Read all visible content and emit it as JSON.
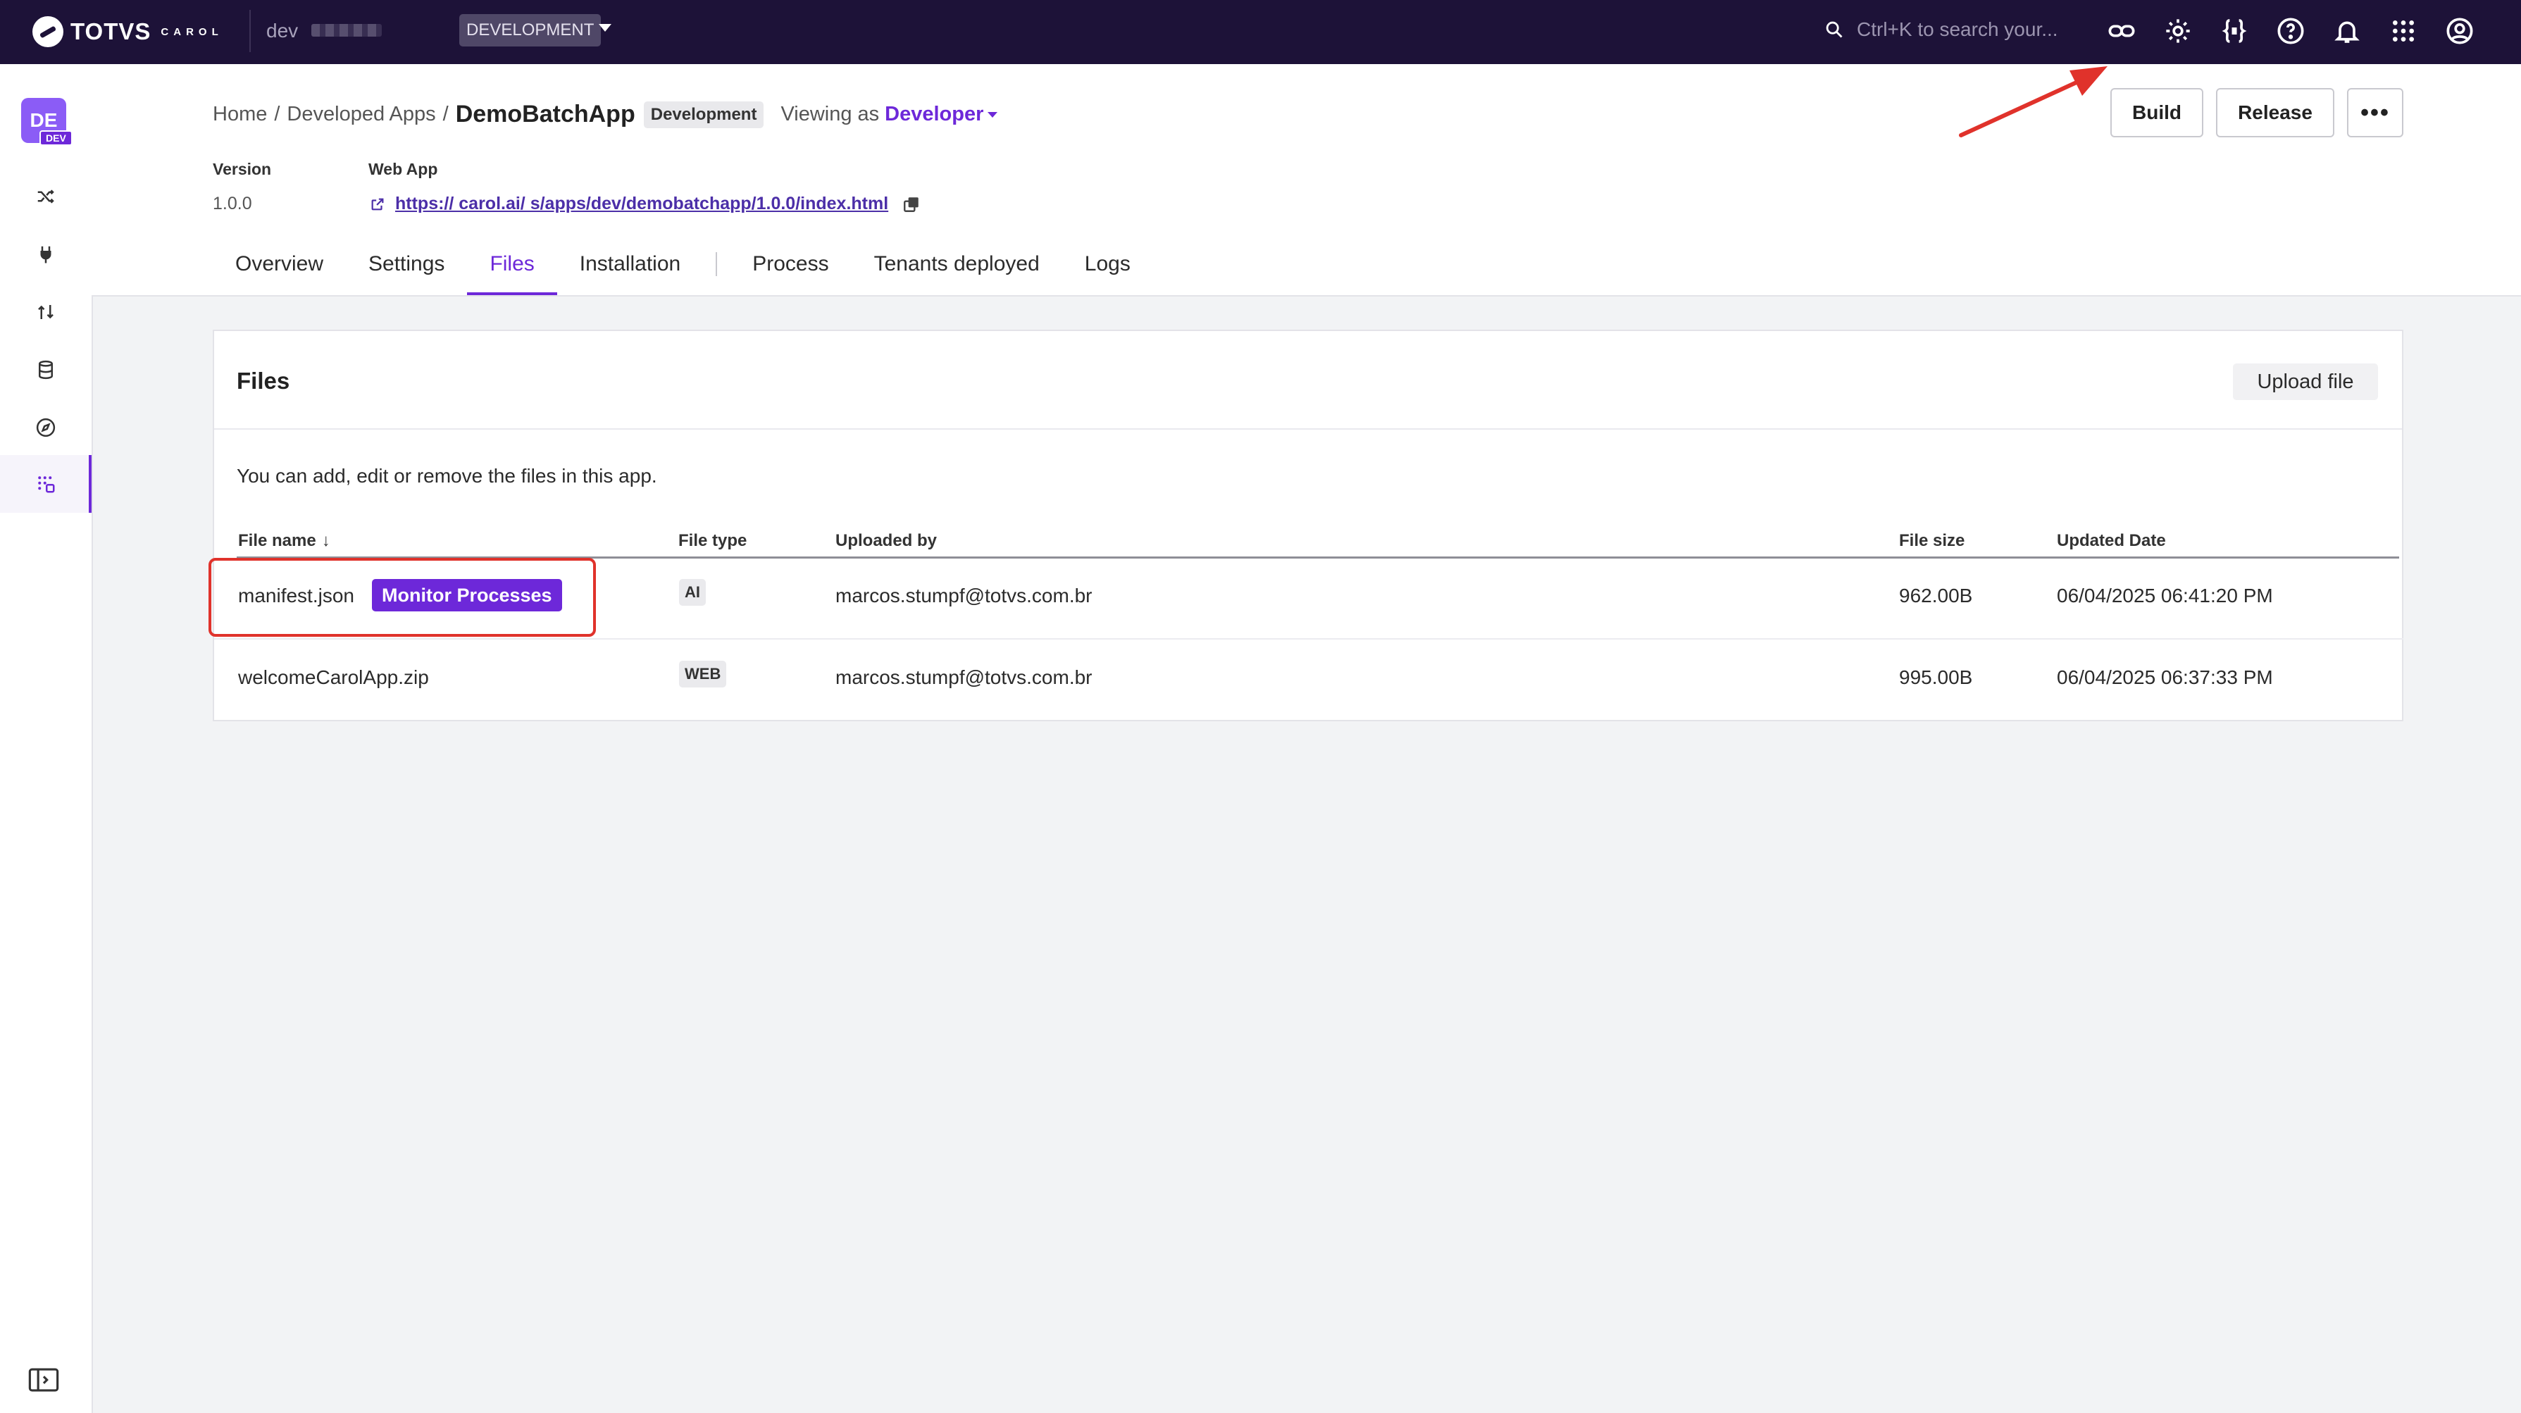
{
  "topbar": {
    "logo_text": "TOTVS",
    "logo_sub": "CAROL",
    "env_name": "dev",
    "env_badge": "DEVELOPMENT",
    "search_placeholder": "Ctrl+K to search your..."
  },
  "topbar_icons": [
    "link-icon",
    "settings-icon",
    "code-icon",
    "help-icon",
    "bell-icon",
    "apps-grid-icon",
    "account-icon"
  ],
  "rail": {
    "avatar": "DE",
    "avatar_badge": "DEV",
    "items": [
      "shuffle-icon",
      "plug-icon",
      "process-arrows-icon",
      "database-icon",
      "compass-icon",
      "apps-icon"
    ]
  },
  "breadcrumb": {
    "home": "Home",
    "sep": "/",
    "developed_apps": "Developed Apps",
    "app_name": "DemoBatchApp",
    "env_pill": "Development",
    "viewing_as": "Viewing as",
    "role": "Developer"
  },
  "actions": {
    "build": "Build",
    "release": "Release",
    "more": "•••"
  },
  "meta": {
    "version_label": "Version",
    "version_value": "1.0.0",
    "webapp_label": "Web App",
    "webapp_url": "https://        carol.ai/          s/apps/dev/demobatchapp/1.0.0/index.html"
  },
  "tabs": [
    "Overview",
    "Settings",
    "Files",
    "Installation",
    "Process",
    "Tenants deployed",
    "Logs"
  ],
  "active_tab": "Files",
  "files_card": {
    "title": "Files",
    "upload_button": "Upload file",
    "description": "You can add, edit or remove the files in this app.",
    "columns": [
      "File name",
      "File type",
      "Uploaded by",
      "File size",
      "Updated Date"
    ],
    "sort_indicator": "↓",
    "rows": [
      {
        "name": "manifest.json",
        "badge": "Monitor Processes",
        "type": "AI",
        "uploaded_by": "marcos.stumpf@totvs.com.br",
        "size": "962.00B",
        "updated": "06/04/2025 06:41:20 PM"
      },
      {
        "name": "welcomeCarolApp.zip",
        "badge": "",
        "type": "WEB",
        "uploaded_by": "marcos.stumpf@totvs.com.br",
        "size": "995.00B",
        "updated": "06/04/2025 06:37:33 PM"
      }
    ]
  },
  "colors": {
    "topbar_bg": "#1d1238",
    "accent": "#6d28d9",
    "annotation": "#e0322b",
    "page_bg": "#f2f3f5"
  }
}
